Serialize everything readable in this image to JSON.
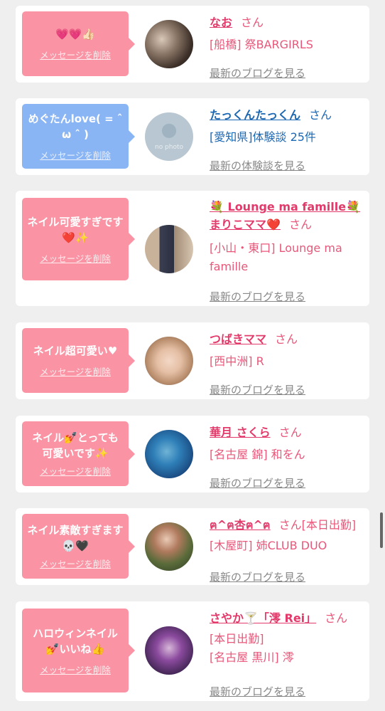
{
  "cards": [
    {
      "message": "💗💗👍🏻",
      "delete_label": "メッセージを削除",
      "name": "なお",
      "honorific": "さん",
      "lines": [
        "[船橋] 祭BARGIRLS"
      ],
      "link": "最新のブログを見る",
      "avatar_icon": "avatar-photo-icon"
    },
    {
      "message": "めぐたんlove( = ˆ ω ˆ )",
      "delete_label": "メッセージを削除",
      "name": "たっくんたっくん",
      "honorific": "さん",
      "lines": [
        "[愛知県]体験談 25件"
      ],
      "link": "最新の体験談を見る",
      "avatar_icon": "no-photo-icon",
      "avatar_caption": "no photo"
    },
    {
      "message": "ネイル可愛すぎです❤️✨",
      "delete_label": "メッセージを削除",
      "name": "💐 Lounge ma famille💐 まりこママ❤️",
      "honorific": "さん",
      "lines": [
        "[小山・東口] Lounge ma famille"
      ],
      "link": "最新のブログを見る",
      "avatar_icon": "avatar-photo-icon"
    },
    {
      "message": "ネイル超可愛い♥",
      "delete_label": "メッセージを削除",
      "name": "つばきママ",
      "honorific": "さん",
      "lines": [
        "[西中洲] R"
      ],
      "link": "最新のブログを見る",
      "avatar_icon": "avatar-photo-icon"
    },
    {
      "message": "ネイル💅とっても可愛いです✨",
      "delete_label": "メッセージを削除",
      "name": "華月 さくら",
      "honorific": "さん",
      "lines": [
        "[名古屋 錦] 和をん"
      ],
      "link": "最新のブログを見る",
      "avatar_icon": "avatar-photo-icon"
    },
    {
      "message": "ネイル素敵すぎます💀🖤",
      "delete_label": "メッセージを削除",
      "name": "ฅ^ฅ杏ฅ^ฅ",
      "honorific": "さん[本日出勤]",
      "lines": [
        "[木屋町] 姉CLUB DUO"
      ],
      "link": "最新のブログを見る",
      "avatar_icon": "avatar-photo-icon"
    },
    {
      "message": "ハロウィンネイル💅いいね👍",
      "delete_label": "メッセージを削除",
      "name": "さやか🍸「澪 Rei」",
      "honorific": "さん",
      "lines": [
        "[本日出勤]",
        "[名古屋 黒川] 澪"
      ],
      "link": "最新のブログを見る",
      "avatar_icon": "avatar-photo-icon"
    }
  ],
  "colors": {
    "pink_bubble": "#fa94a4",
    "blue_bubble": "#8ab5f5",
    "pink_text": "#e8577a",
    "blue_text": "#1d68b3",
    "link_gray": "#888888"
  }
}
